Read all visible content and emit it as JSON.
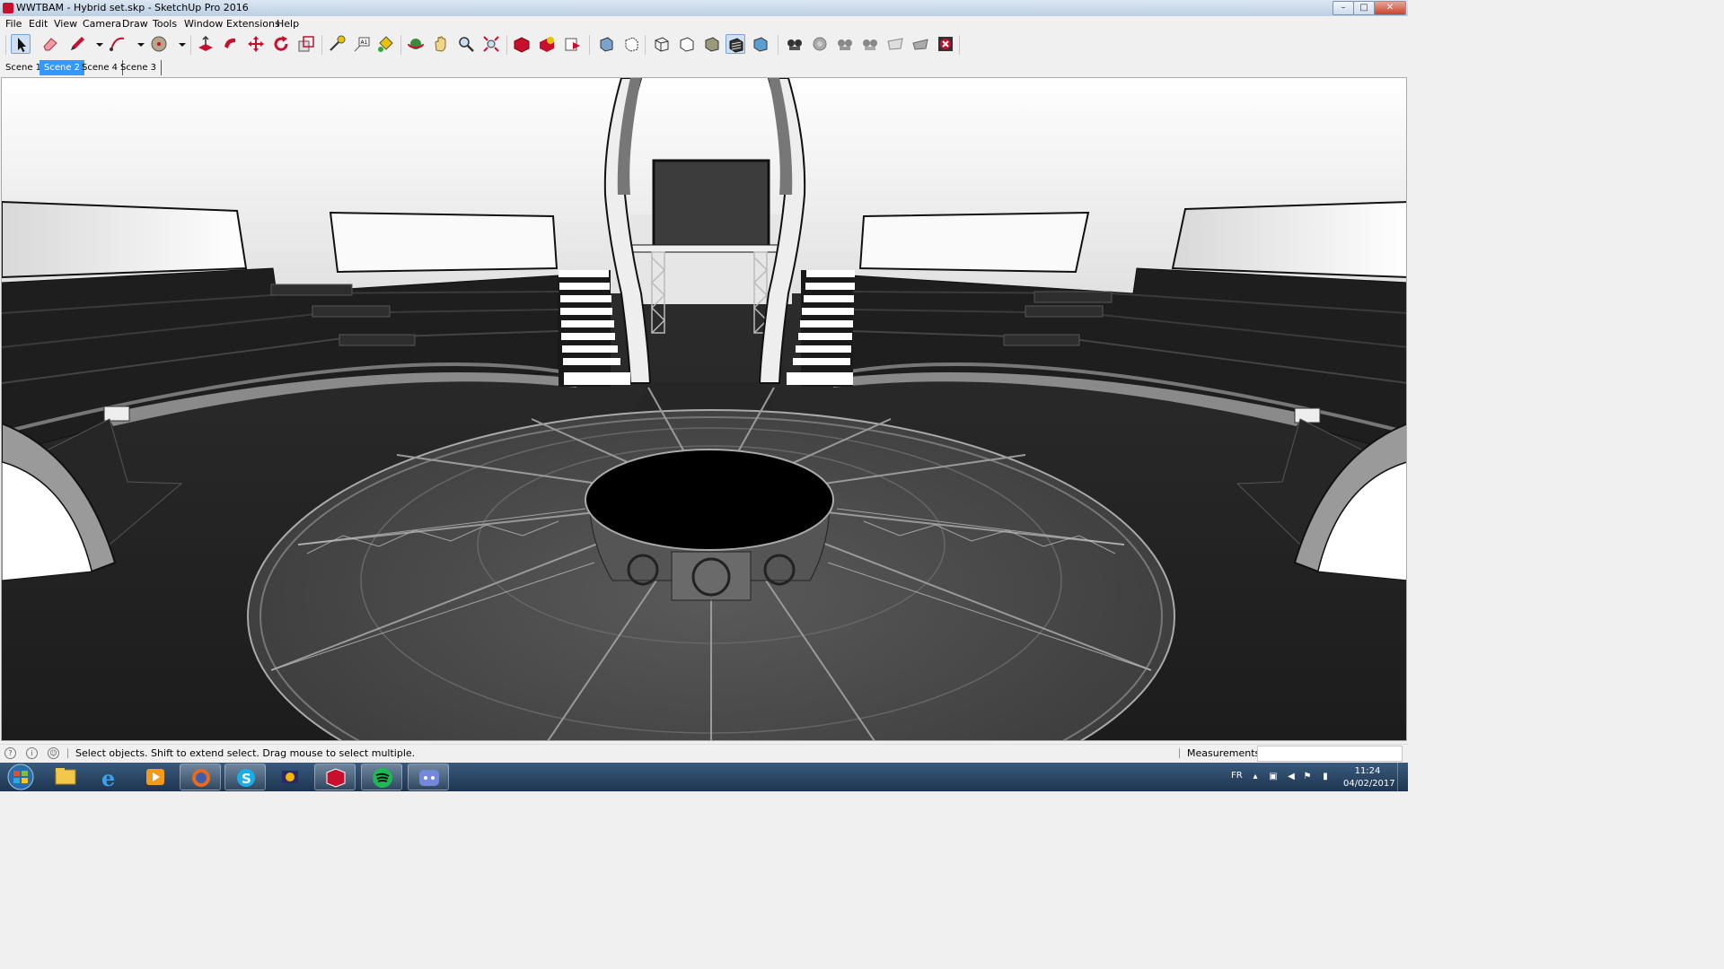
{
  "window": {
    "title": "WWTBAM - Hybrid set.skp - SketchUp Pro 2016",
    "controls": {
      "minimize": "–",
      "maximize": "□",
      "close": "✕"
    }
  },
  "menu": [
    "File",
    "Edit",
    "View",
    "Camera",
    "Draw",
    "Tools",
    "Window",
    "Extensions",
    "Help"
  ],
  "toolbar": {
    "tools": [
      {
        "icon": "select-arrow-icon",
        "active": true
      },
      {
        "icon": "eraser-icon"
      },
      {
        "icon": "pencil-line-icon"
      },
      {
        "icon": "dropdown-arrow-icon"
      },
      {
        "icon": "arc-icon"
      },
      {
        "icon": "dropdown-arrow-icon"
      },
      {
        "icon": "shape-circle-icon"
      },
      {
        "icon": "dropdown-arrow-icon"
      },
      {
        "icon": "push-pull-icon"
      },
      {
        "icon": "follow-me-icon"
      },
      {
        "icon": "move-icon"
      },
      {
        "icon": "rotate-icon"
      },
      {
        "icon": "scale-icon"
      },
      {
        "icon": "tape-measure-icon"
      },
      {
        "icon": "text-tool-icon"
      },
      {
        "icon": "paint-bucket-icon"
      },
      {
        "icon": "orbit-icon"
      },
      {
        "icon": "pan-hand-icon"
      },
      {
        "icon": "zoom-icon"
      },
      {
        "icon": "zoom-extents-icon"
      },
      {
        "icon": "warehouse-icon"
      },
      {
        "icon": "extension-warehouse-icon"
      },
      {
        "icon": "send-to-layout-icon"
      },
      {
        "icon": "xray-style-icon"
      },
      {
        "icon": "back-edges-style-icon"
      },
      {
        "icon": "wireframe-style-icon"
      },
      {
        "icon": "hidden-line-style-icon"
      },
      {
        "icon": "shaded-style-icon"
      },
      {
        "icon": "shaded-textures-style-icon",
        "active": true
      },
      {
        "icon": "monochrome-style-icon"
      },
      {
        "icon": "sandbox-smoove-icon"
      },
      {
        "icon": "sandbox-stamp-icon"
      },
      {
        "icon": "sandbox-drape-icon"
      },
      {
        "icon": "sandbox-add-detail-icon"
      },
      {
        "icon": "sandbox-flip-edge-icon"
      },
      {
        "icon": "sandbox-from-contours-icon"
      },
      {
        "icon": "sandbox-from-scratch-icon"
      }
    ]
  },
  "scenes": [
    {
      "label": "Scene 1",
      "active": false
    },
    {
      "label": "Scene 2",
      "active": true
    },
    {
      "label": "Scene 4",
      "active": false
    },
    {
      "label": "Scene 3",
      "active": false
    }
  ],
  "status": {
    "message": "Select objects. Shift to extend select. Drag mouse to select multiple.",
    "measurements_label": "Measurements",
    "measurements_value": ""
  },
  "taskbar": {
    "apps": [
      {
        "name": "windows-explorer-icon",
        "open": false
      },
      {
        "name": "internet-explorer-icon",
        "open": false
      },
      {
        "name": "media-player-icon",
        "open": false
      },
      {
        "name": "firefox-icon",
        "open": true
      },
      {
        "name": "skype-icon",
        "open": true
      },
      {
        "name": "game-app-icon",
        "open": false
      },
      {
        "name": "sketchup-icon",
        "open": true
      },
      {
        "name": "spotify-icon",
        "open": true
      },
      {
        "name": "discord-icon",
        "open": true
      }
    ],
    "language": "FR",
    "time": "11:24",
    "date": "04/02/2017"
  },
  "colors": {
    "selection_blue": "#3399ff",
    "sketchup_red": "#c8102e",
    "taskbar_blue": "#1d3550"
  }
}
